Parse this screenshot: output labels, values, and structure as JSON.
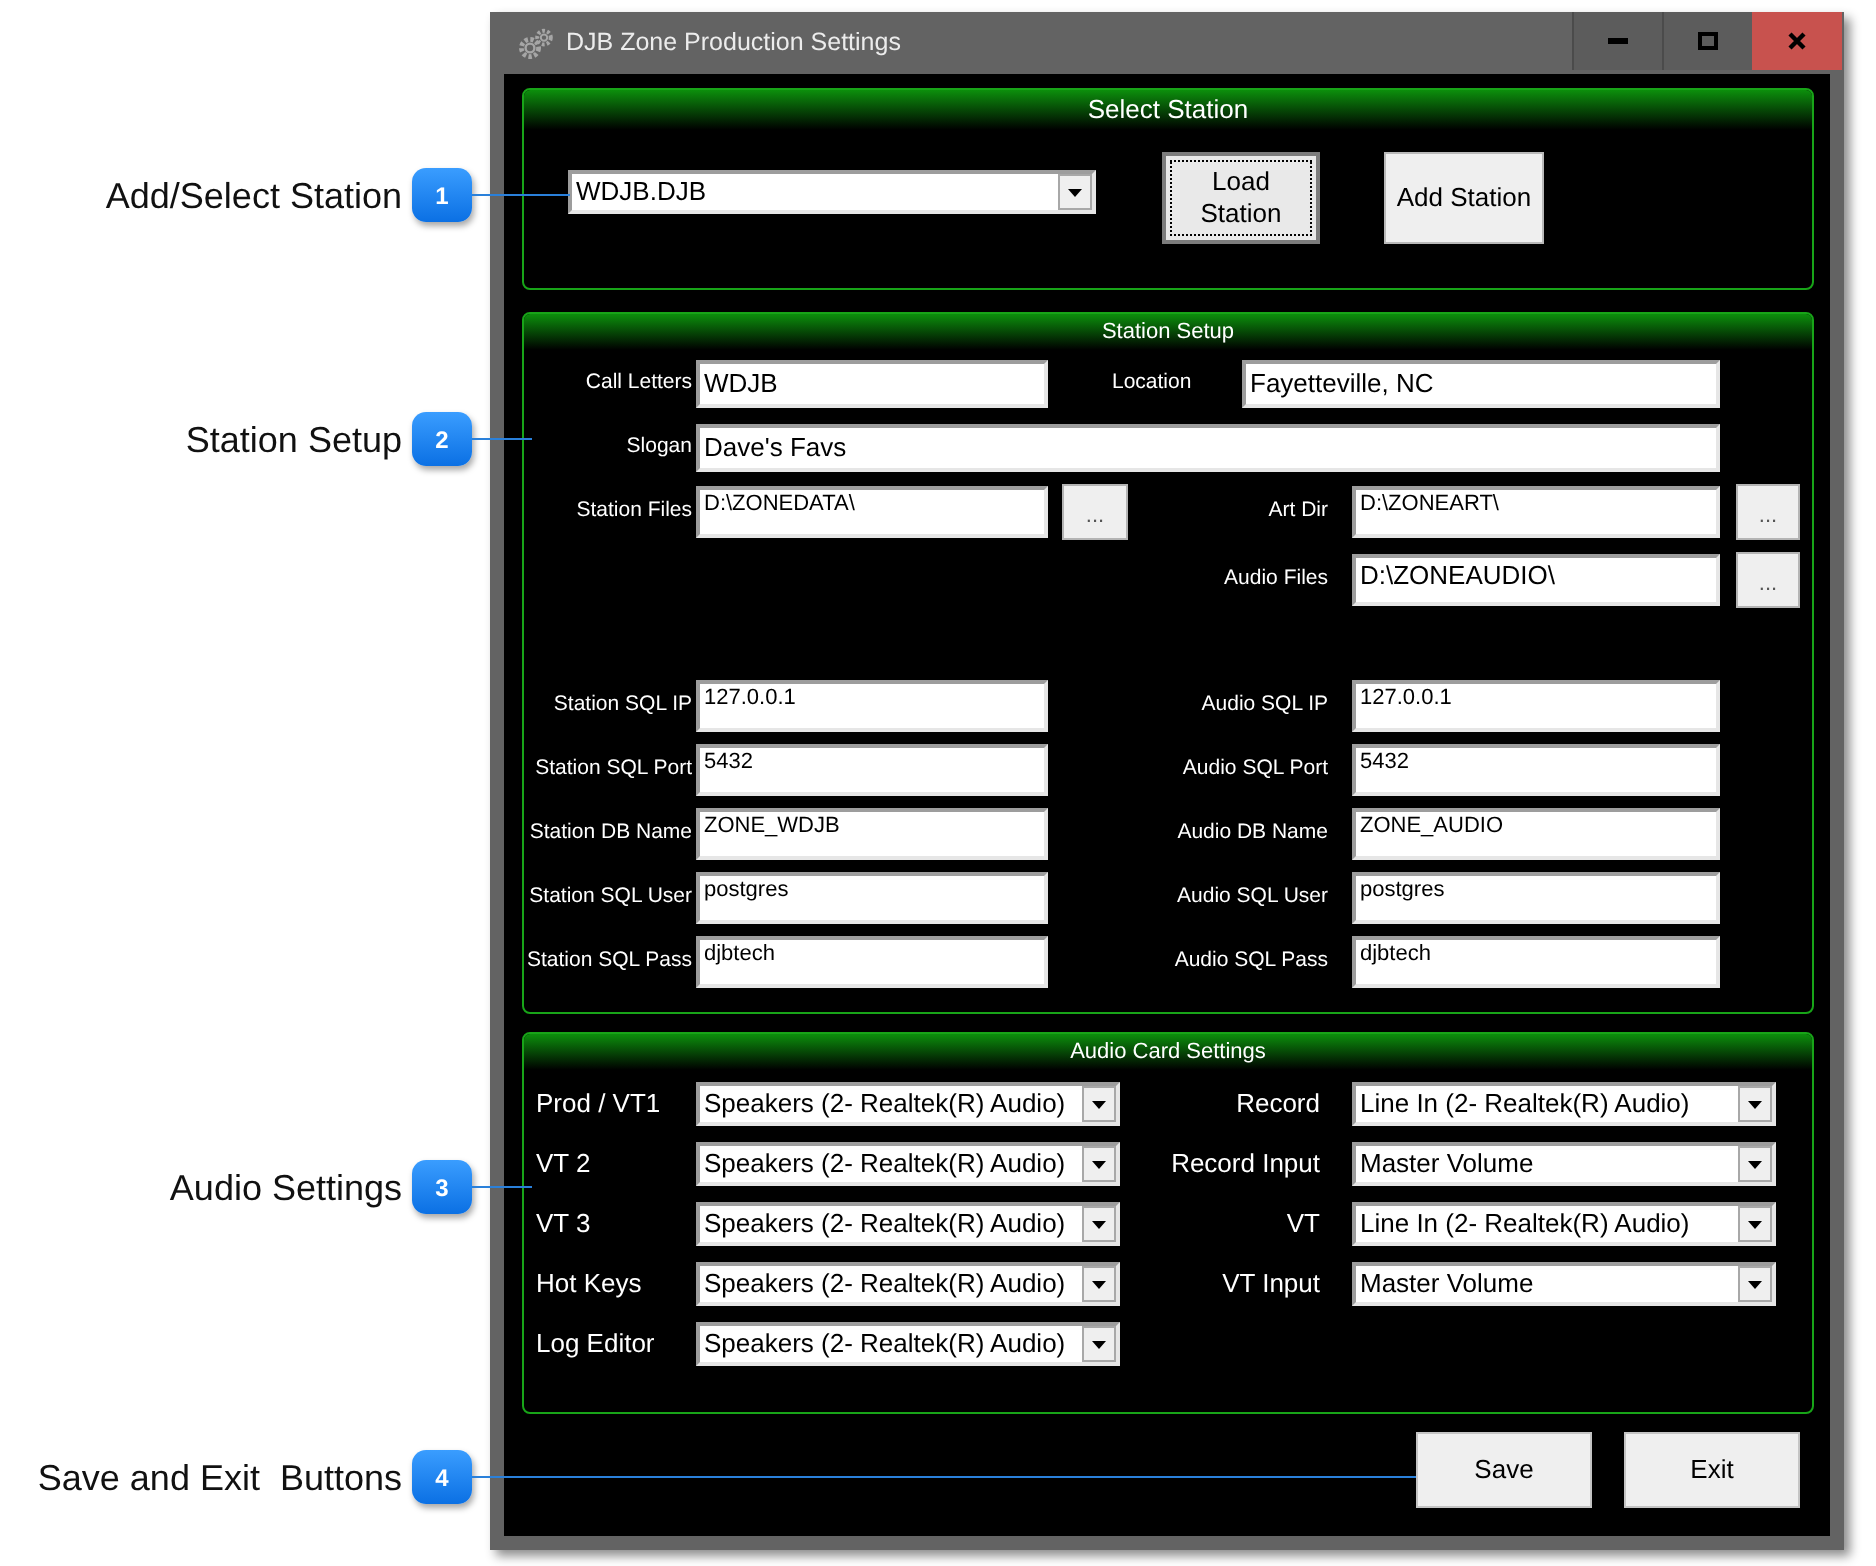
{
  "callouts": [
    {
      "number": "1",
      "label": "Add/Select Station"
    },
    {
      "number": "2",
      "label": "Station Setup"
    },
    {
      "number": "3",
      "label": "Audio Settings"
    },
    {
      "number": "4",
      "label": "Save and Exit  Buttons"
    }
  ],
  "window": {
    "title": "DJB Zone Production Settings"
  },
  "select_station": {
    "title": "Select Station",
    "station": "WDJB.DJB",
    "buttons": [
      {
        "label": "Load Station",
        "focused": true
      },
      {
        "label": "Add Station",
        "focused": false
      }
    ]
  },
  "station_setup": {
    "title": "Station Setup",
    "identity": [
      {
        "label": "Call Letters",
        "value": "WDJB"
      },
      {
        "label": "Location",
        "value": "Fayetteville, NC"
      }
    ],
    "slogan": {
      "label": "Slogan",
      "value": "Dave's Favs"
    },
    "folders": [
      {
        "label": "Station Files",
        "value": "D:\\ZONEDATA\\",
        "browse": "..."
      },
      {
        "label": "Art Dir",
        "value": "D:\\ZONEART\\",
        "browse": "..."
      },
      {
        "label": "Audio Files",
        "value": "D:\\ZONEAUDIO\\",
        "browse": "..."
      }
    ],
    "station_sql": [
      {
        "label": "Station SQL IP",
        "value": "127.0.0.1"
      },
      {
        "label": "Station SQL Port",
        "value": "5432"
      },
      {
        "label": "Station DB Name",
        "value": "ZONE_WDJB"
      },
      {
        "label": "Station SQL User",
        "value": "postgres"
      },
      {
        "label": "Station SQL Pass",
        "value": "djbtech"
      }
    ],
    "audio_sql": [
      {
        "label": "Audio SQL IP",
        "value": "127.0.0.1"
      },
      {
        "label": "Audio SQL Port",
        "value": "5432"
      },
      {
        "label": "Audio DB Name",
        "value": "ZONE_AUDIO"
      },
      {
        "label": "Audio SQL User",
        "value": "postgres"
      },
      {
        "label": "Audio SQL Pass",
        "value": "djbtech"
      }
    ]
  },
  "audio_card_settings": {
    "title": "Audio Card Settings",
    "outputs": [
      {
        "label": "Prod / VT1",
        "device": "Speakers (2- Realtek(R) Audio)"
      },
      {
        "label": "VT 2",
        "device": "Speakers (2- Realtek(R) Audio)"
      },
      {
        "label": "VT 3",
        "device": "Speakers (2- Realtek(R) Audio)"
      },
      {
        "label": "Hot Keys",
        "device": "Speakers (2- Realtek(R) Audio)"
      },
      {
        "label": "Log Editor",
        "device": "Speakers (2- Realtek(R) Audio)"
      }
    ],
    "inputs": [
      {
        "label": "Record",
        "device": "Line In (2- Realtek(R) Audio)"
      },
      {
        "label": "Record Input",
        "device": "Master Volume"
      },
      {
        "label": "VT",
        "device": "Line In (2- Realtek(R) Audio)"
      },
      {
        "label": "VT Input",
        "device": "Master Volume"
      }
    ]
  },
  "buttons": [
    {
      "label": "Save"
    },
    {
      "label": "Exit"
    }
  ]
}
